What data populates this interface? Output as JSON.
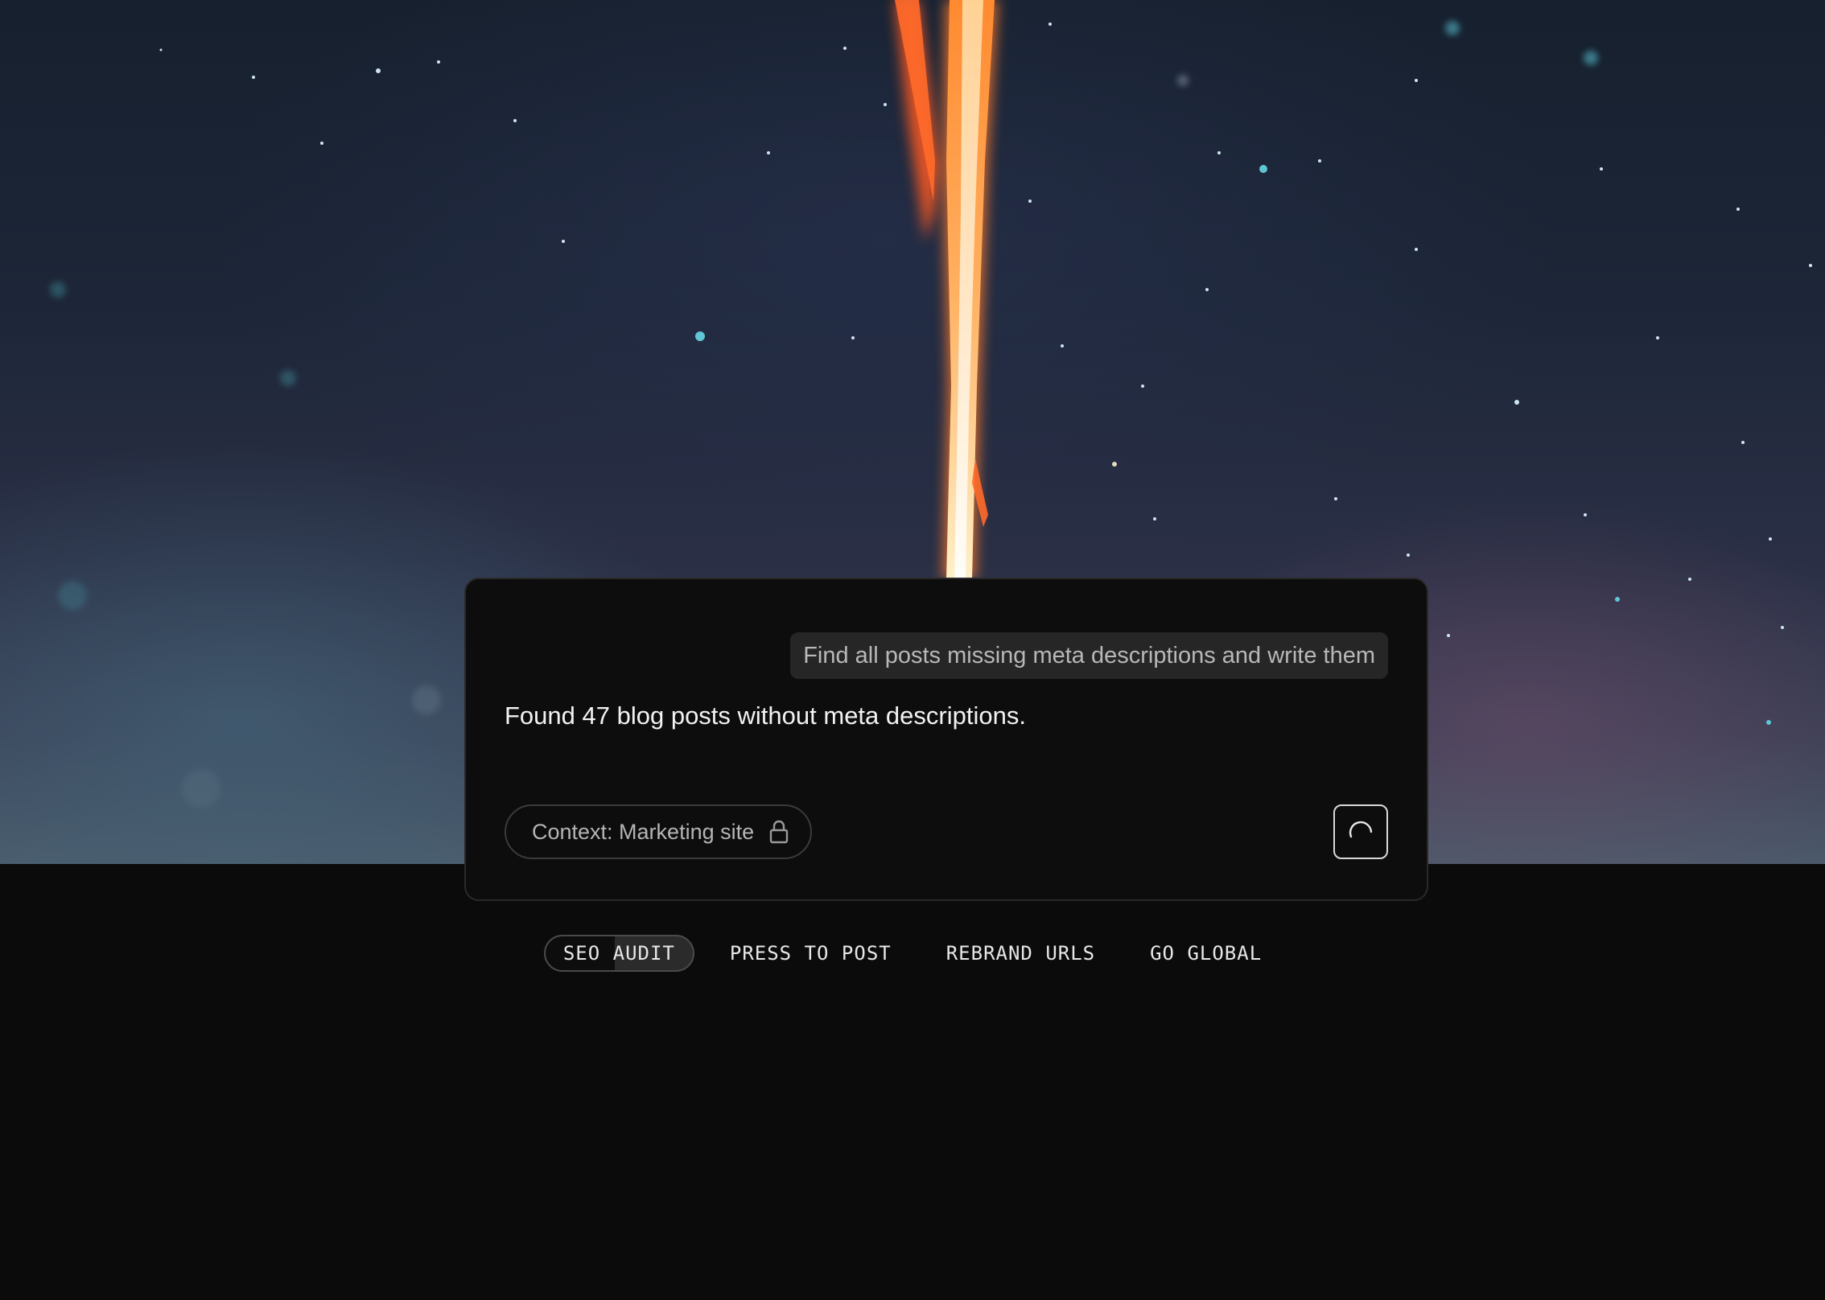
{
  "chat": {
    "user_message": "Find all posts missing meta descriptions and write them",
    "assistant_message": "Found 47 blog posts without meta descriptions.",
    "context_label": "Context: Marketing site",
    "context_icon": "lock-icon",
    "status_icon": "loading-spinner-icon"
  },
  "tabs": [
    {
      "label": "SEO AUDIT",
      "active": true
    },
    {
      "label": "PRESS TO POST",
      "active": false
    },
    {
      "label": "REBRAND URLS",
      "active": false
    },
    {
      "label": "GO GLOBAL",
      "active": false
    }
  ],
  "colors": {
    "page_background": "#0b0b0b",
    "card_background": "#0d0d0d",
    "user_bubble_background": "#262626",
    "rocket_glow": "#ff7a2a"
  }
}
